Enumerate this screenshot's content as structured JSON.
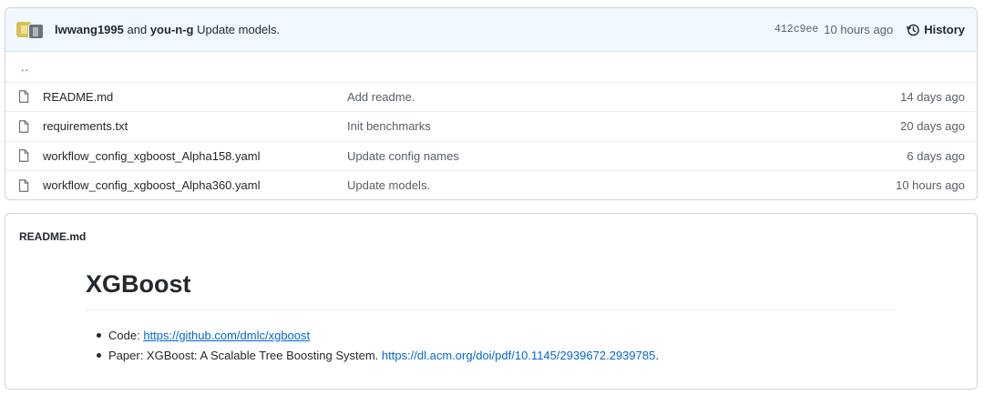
{
  "commit": {
    "author1": "lwwang1995",
    "conjunction": "and",
    "author2": "you-n-g",
    "message": "Update models.",
    "sha": "412c9ee",
    "age": "10 hours ago",
    "history_label": "History"
  },
  "updir": "..",
  "files": [
    {
      "name": "README.md",
      "message": "Add readme.",
      "age": "14 days ago"
    },
    {
      "name": "requirements.txt",
      "message": "Init benchmarks",
      "age": "20 days ago"
    },
    {
      "name": "workflow_config_xgboost_Alpha158.yaml",
      "message": "Update config names",
      "age": "6 days ago"
    },
    {
      "name": "workflow_config_xgboost_Alpha360.yaml",
      "message": "Update models.",
      "age": "10 hours ago"
    }
  ],
  "readme": {
    "header": "README.md",
    "title": "XGBoost",
    "bullet1_prefix": "Code: ",
    "bullet1_link": "https://github.com/dmlc/xgboost",
    "bullet2_prefix": "Paper: XGBoost: A Scalable Tree Boosting System. ",
    "bullet2_link": "https://dl.acm.org/doi/pdf/10.1145/2939672.2939785",
    "bullet2_suffix": "."
  },
  "colors": {
    "link": "#0366d6",
    "commit_bar_bg": "#f1f8ff",
    "border": "#d1d5da"
  },
  "icons": [
    "file-icon",
    "history-icon",
    "avatar"
  ]
}
